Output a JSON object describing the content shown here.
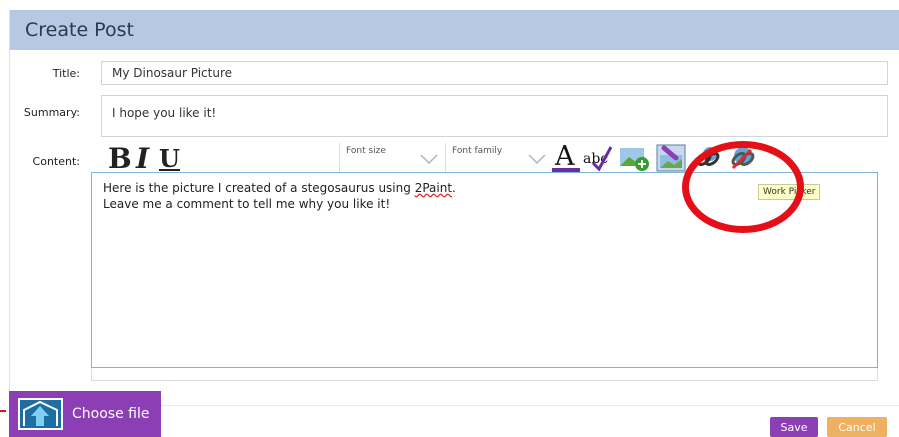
{
  "header": {
    "title": "Create Post"
  },
  "form": {
    "title_label": "Title:",
    "title_value": "My Dinosaur Picture",
    "summary_label": "Summary:",
    "summary_value": "I hope you like it!",
    "content_label": "Content:"
  },
  "toolbar": {
    "bold": "B",
    "italic": "I",
    "underline": "U",
    "font_size": "Font size",
    "font_family": "Font family",
    "font_color": "A",
    "spell": "abc"
  },
  "editor": {
    "line1_pre": "Here is the picture I created of a stegosaurus using ",
    "line1_word": "2Paint",
    "line1_post": ".",
    "line2": "Leave me a comment to tell me why you like it!"
  },
  "tooltip": "Work Picker",
  "choose_file": "Choose file",
  "buttons": {
    "save": "Save",
    "cancel": "Cancel"
  },
  "icons": [
    "bold-icon",
    "italic-icon",
    "underline-icon",
    "align-left-icon",
    "align-center-icon",
    "align-right-icon",
    "align-justify-icon",
    "ordered-list-icon",
    "unordered-list-icon",
    "font-color-icon",
    "spellcheck-icon",
    "insert-image-icon",
    "work-picker-icon",
    "link-icon",
    "unlink-icon",
    "upload-icon"
  ],
  "colors": {
    "header": "#b6c8e4",
    "accent": "#8c3fb5",
    "cancel": "#f0b062",
    "highlight_ring": "#e40f17",
    "editor_border": "#7fb1dd"
  }
}
